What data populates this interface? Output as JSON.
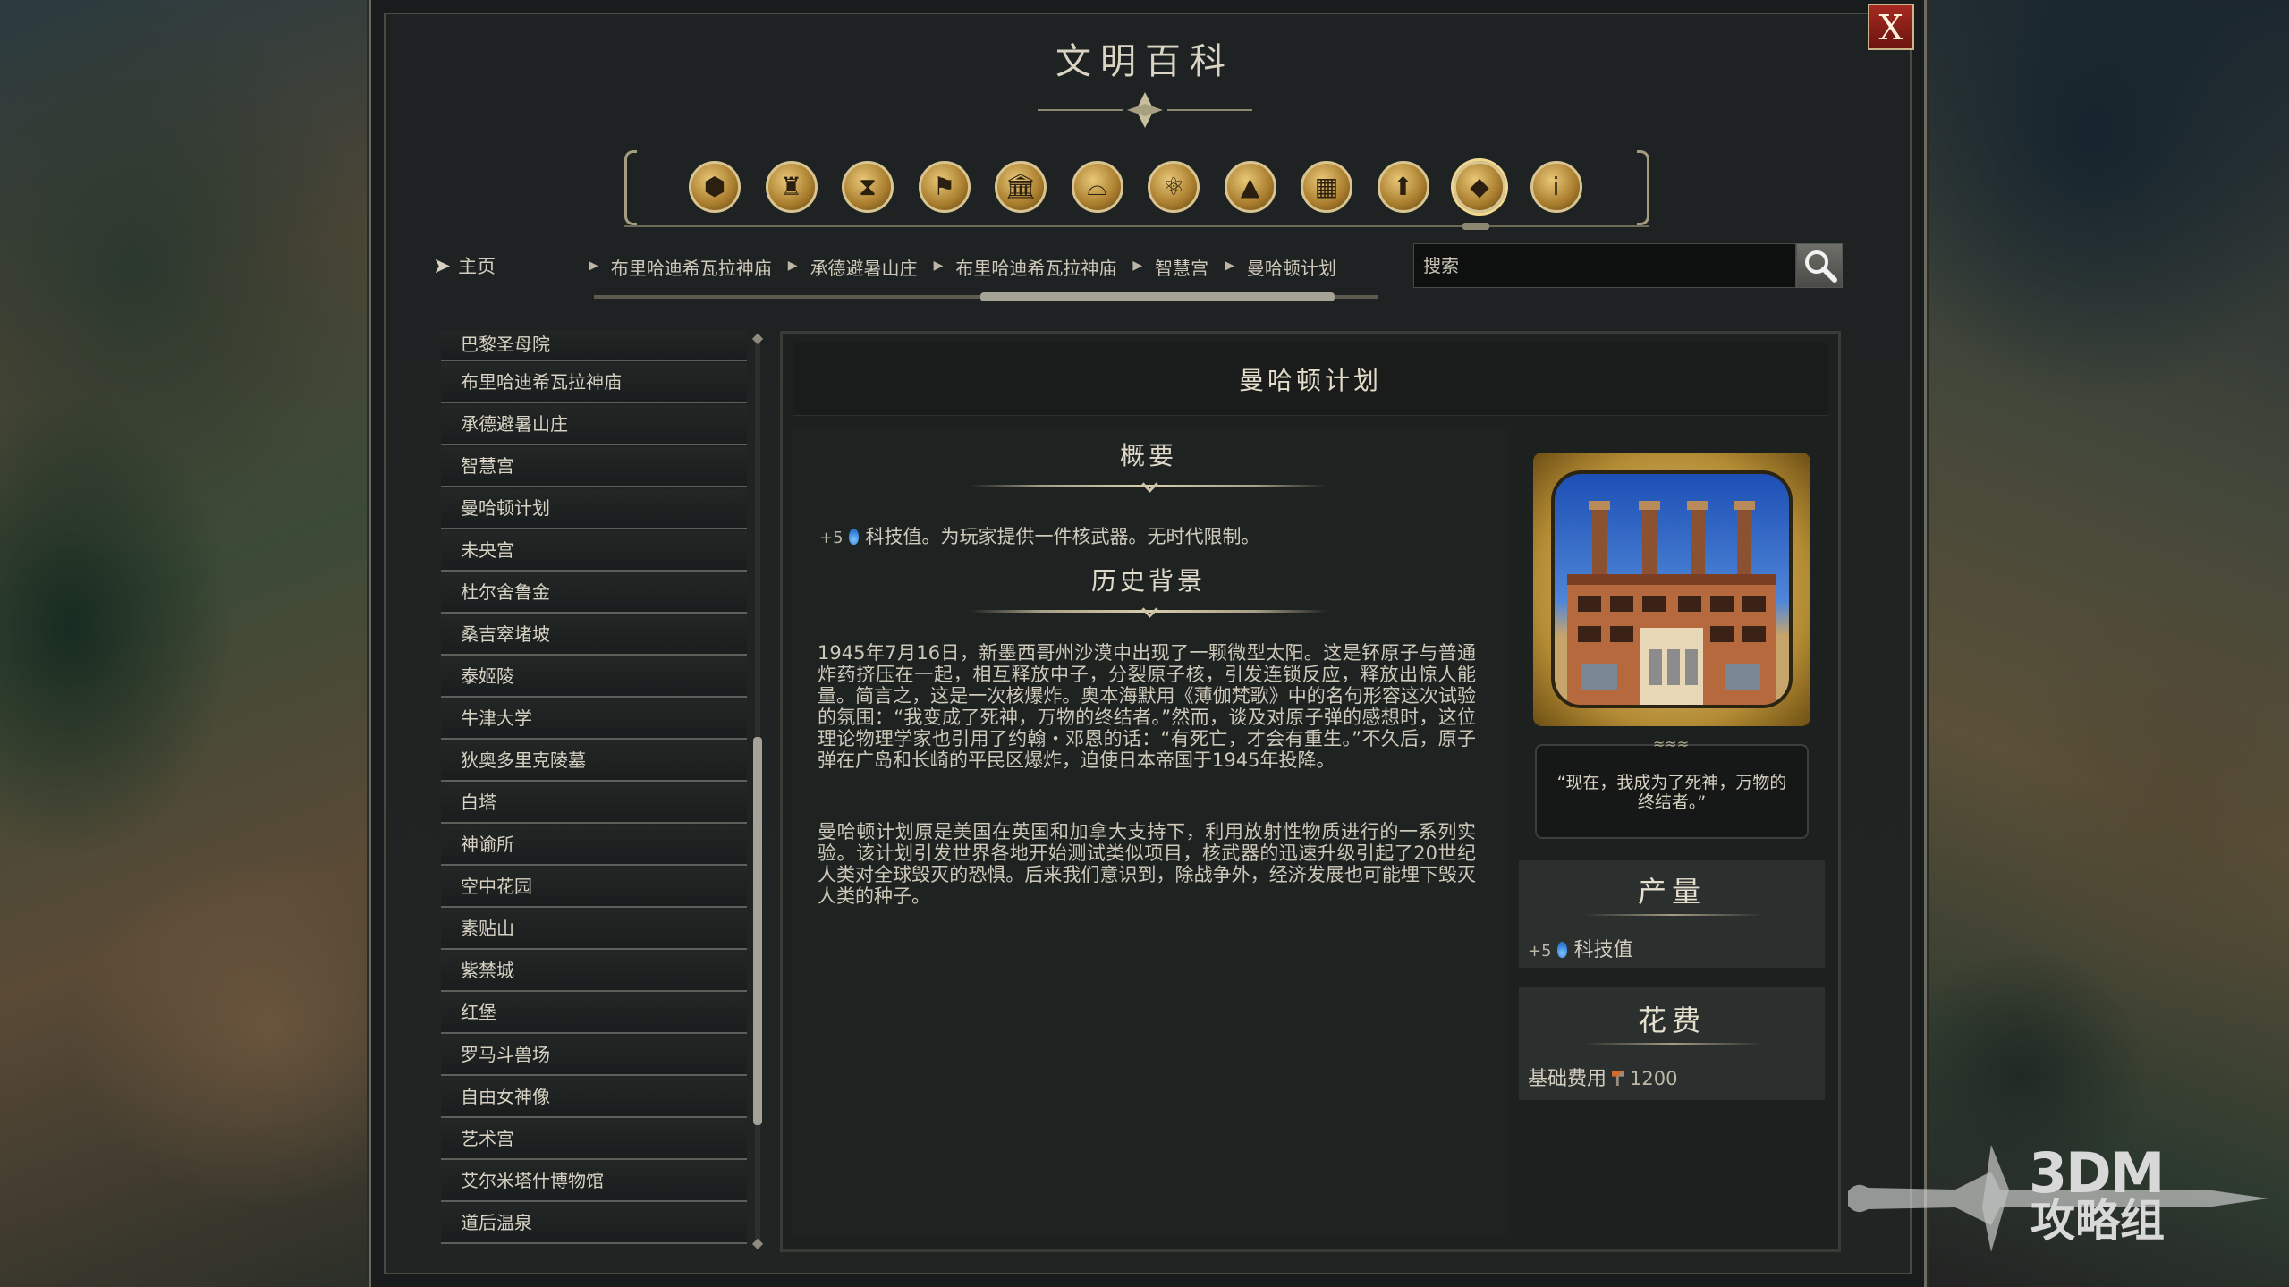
{
  "window": {
    "title": "文明百科",
    "close_label": "X"
  },
  "category_icons": [
    {
      "name": "units-icon",
      "glyph": "⬢"
    },
    {
      "name": "buildings-icon",
      "glyph": "♜"
    },
    {
      "name": "wonders-icon",
      "glyph": "⧗"
    },
    {
      "name": "leaders-icon",
      "glyph": "⚑"
    },
    {
      "name": "civics-icon",
      "glyph": "🏛"
    },
    {
      "name": "religion-icon",
      "glyph": "⌓"
    },
    {
      "name": "technology-icon",
      "glyph": "⚛"
    },
    {
      "name": "terrain-icon",
      "glyph": "▲"
    },
    {
      "name": "districts-icon",
      "glyph": "▦"
    },
    {
      "name": "promotions-icon",
      "glyph": "⬆"
    },
    {
      "name": "great-works-icon",
      "glyph": "◆"
    },
    {
      "name": "info-icon",
      "glyph": "i"
    }
  ],
  "active_category_index": 10,
  "breadcrumb": {
    "home_label": "主页",
    "items": [
      "布里哈迪希瓦拉神庙",
      "承德避暑山庄",
      "布里哈迪希瓦拉神庙",
      "智慧宫",
      "曼哈顿计划"
    ]
  },
  "search": {
    "placeholder": "搜索"
  },
  "list": {
    "items": [
      "巴黎圣母院",
      "布里哈迪希瓦拉神庙",
      "承德避暑山庄",
      "智慧宫",
      "曼哈顿计划",
      "未央宫",
      "杜尔舍鲁金",
      "桑吉窣堵坡",
      "泰姬陵",
      "牛津大学",
      "狄奥多里克陵墓",
      "白塔",
      "神谕所",
      "空中花园",
      "素贴山",
      "紫禁城",
      "红堡",
      "罗马斗兽场",
      "自由女神像",
      "艺术宫",
      "艾尔米塔什博物馆",
      "道后温泉"
    ]
  },
  "article": {
    "title": "曼哈顿计划",
    "summary_heading": "概要",
    "summary_prefix": "+5",
    "summary_text": "科技值。为玩家提供一件核武器。无时代限制。",
    "history_heading": "历史背景",
    "history_p1": "1945年7月16日，新墨西哥州沙漠中出现了一颗微型太阳。这是钚原子与普通炸药挤压在一起，相互释放中子，分裂原子核，引发连锁反应，释放出惊人能量。简言之，这是一次核爆炸。奥本海默用《薄伽梵歌》中的名句形容这次试验的氛围：“我变成了死神，万物的终结者。”然而，谈及对原子弹的感想时，这位理论物理学家也引用了约翰・邓恩的话：“有死亡，才会有重生。”不久后，原子弹在广岛和长崎的平民区爆炸，迫使日本帝国于1945年投降。",
    "history_p2": "曼哈顿计划原是美国在英国和加拿大支持下，利用放射性物质进行的一系列实验。该计划引发世界各地开始测试类似项目，核武器的迅速升级引起了20世纪人类对全球毁灭的恐惧。后来我们意识到，除战争外，经济发展也可能埋下毁灭人类的种子。",
    "quote": "“现在，我成为了死神，万物的终结者。”"
  },
  "yield_panel": {
    "title": "产量",
    "prefix": "+5",
    "label": "科技值"
  },
  "cost_panel": {
    "title": "花费",
    "label": "基础费用",
    "value": "1200"
  },
  "watermark": {
    "line1": "3DM",
    "line2": "攻略组"
  }
}
